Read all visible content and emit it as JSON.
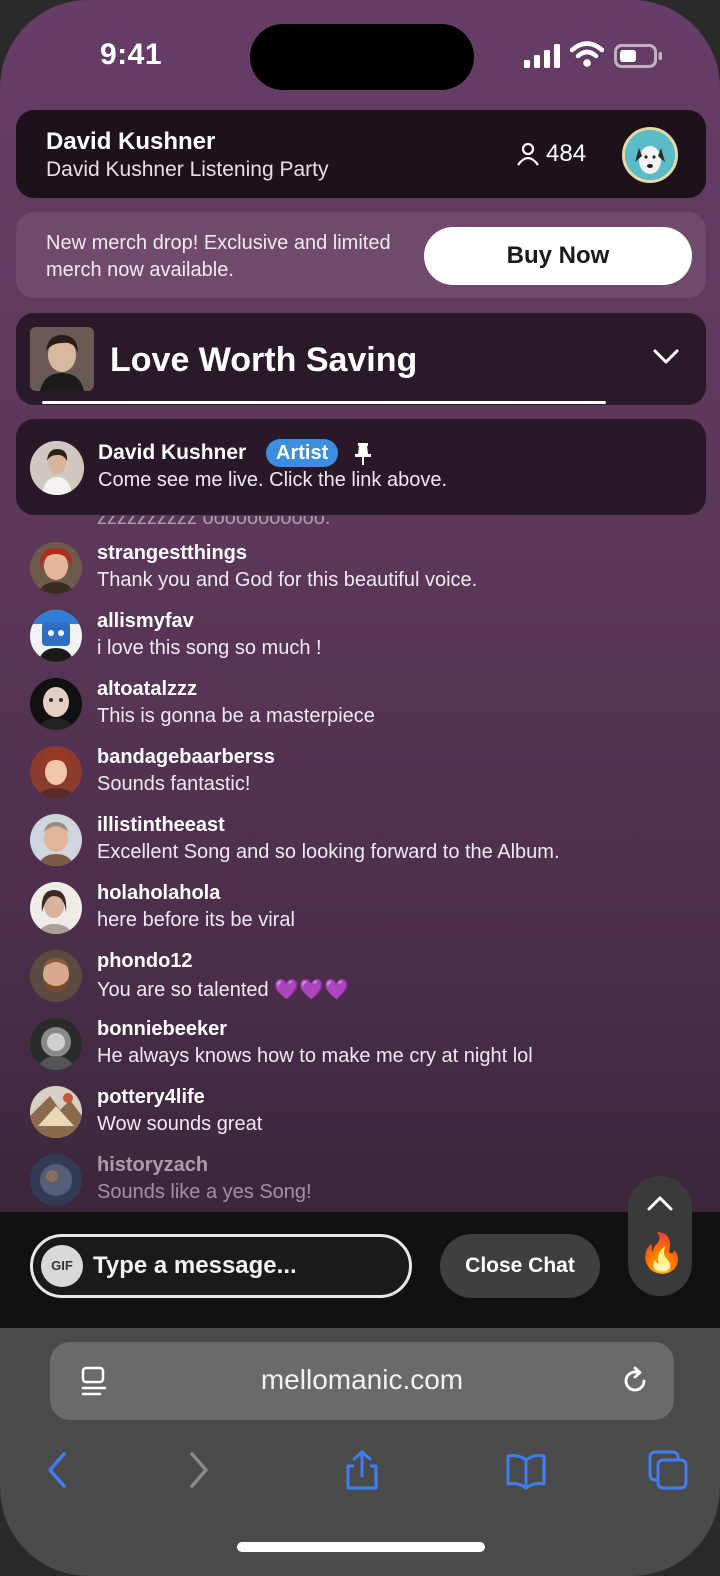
{
  "status_bar": {
    "time": "9:41"
  },
  "header": {
    "artist": "David Kushner",
    "event": "David Kushner Listening Party",
    "viewer_count": "484"
  },
  "merch": {
    "text": "New merch drop! Exclusive and limited merch now available.",
    "button": "Buy Now"
  },
  "now_playing": {
    "title": "Love Worth Saving"
  },
  "pinned": {
    "user": "David Kushner",
    "badge": "Artist",
    "message": "Come see me live. Click the link above."
  },
  "chat": {
    "faded_line": "zzzzzzzzzz ooooooooooo.",
    "messages": [
      {
        "user": "strangestthings",
        "text": "Thank you and God for this beautiful voice."
      },
      {
        "user": "allismyfav",
        "text": "i love this song so much !"
      },
      {
        "user": "altoatalzzz",
        "text": "This is gonna be a masterpiece"
      },
      {
        "user": "bandagebaarberss",
        "text": "Sounds fantastic!"
      },
      {
        "user": "illistintheeast",
        "text": "Excellent Song and so looking forward to the Album."
      },
      {
        "user": "holaholahola",
        "text": "here before its be viral"
      },
      {
        "user": "phondo12",
        "text": "You are so talented 💜💜💜"
      },
      {
        "user": "bonniebeeker",
        "text": "He always knows how to make me cry at night lol"
      },
      {
        "user": "pottery4life",
        "text": "Wow sounds great"
      },
      {
        "user": "historyzach",
        "text": "Sounds like a yes Song!"
      }
    ]
  },
  "composer": {
    "gif_label": "GIF",
    "placeholder": "Type a message...",
    "close_label": "Close Chat",
    "reaction_icon": "🔥"
  },
  "browser": {
    "url": "mellomanic.com"
  },
  "colors": {
    "accent_badge": "#3c8ee0",
    "background": "#5b3759",
    "nav_blue": "#3d7ff2"
  }
}
